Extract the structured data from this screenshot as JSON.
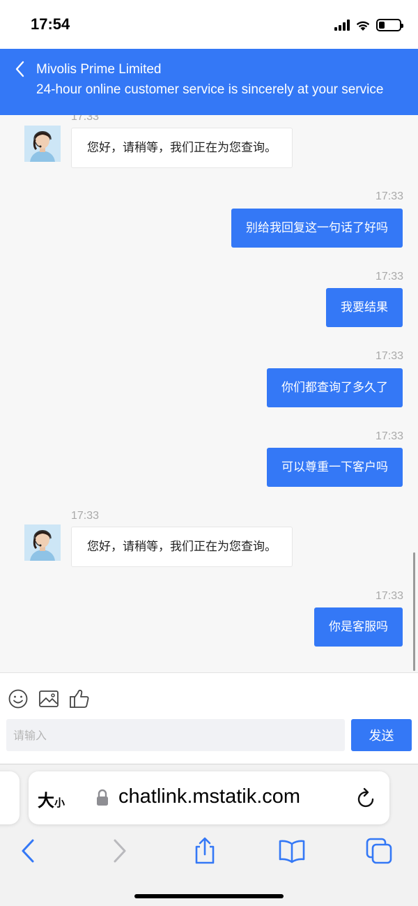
{
  "status_bar": {
    "time": "17:54",
    "icons": [
      "cellular-signal-icon",
      "wifi-icon",
      "battery-icon"
    ]
  },
  "header": {
    "title": "Mivolis Prime Limited",
    "subtitle": "24-hour online customer service is sincerely at your service"
  },
  "messages": [
    {
      "side": "in",
      "time": "17:33",
      "text": "您好，请稍等，我们正在为您查询。"
    },
    {
      "side": "out",
      "time": "17:33",
      "text": "别给我回复这一句话了好吗"
    },
    {
      "side": "out",
      "time": "17:33",
      "text": "我要结果"
    },
    {
      "side": "out",
      "time": "17:33",
      "text": "你们都查询了多久了"
    },
    {
      "side": "out",
      "time": "17:33",
      "text": "可以尊重一下客户吗"
    },
    {
      "side": "in",
      "time": "17:33",
      "text": "您好，请稍等，我们正在为您查询。"
    },
    {
      "side": "out",
      "time": "17:33",
      "text": "你是客服吗"
    }
  ],
  "toolbar": {
    "icons": [
      "emoji-icon",
      "image-icon",
      "thumbs-up-icon"
    ]
  },
  "composer": {
    "placeholder": "请输入",
    "value": "",
    "send_label": "发送"
  },
  "browser": {
    "text_size_big": "大",
    "text_size_small": "小",
    "url": "chatlink.mstatik.com",
    "nav_icons": [
      "back-icon",
      "forward-icon",
      "share-icon",
      "bookmarks-icon",
      "tabs-icon"
    ]
  },
  "colors": {
    "accent": "#3478f6",
    "bubble_in_bg": "#ffffff",
    "chat_bg": "#f7f7f7",
    "timestamp": "#a9a9a9"
  }
}
